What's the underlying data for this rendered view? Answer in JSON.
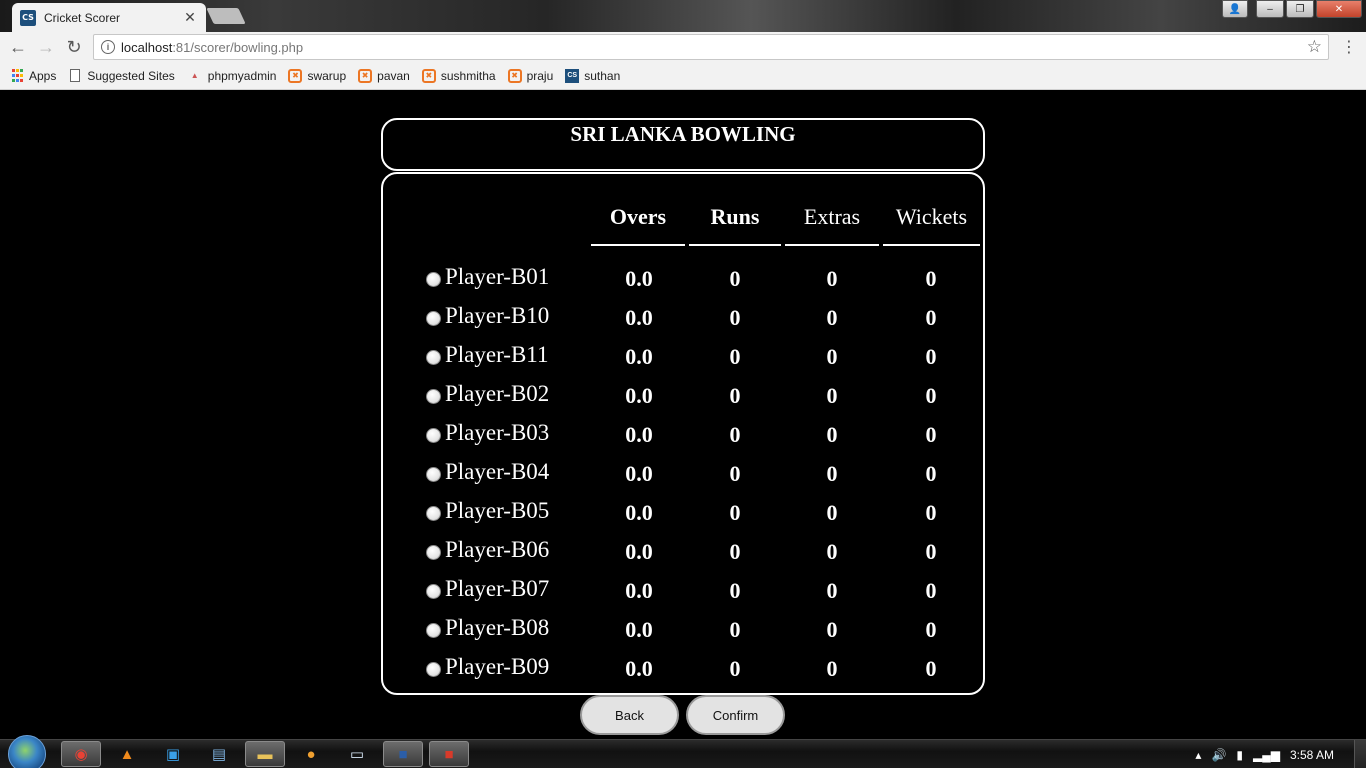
{
  "browser": {
    "tab_title": "Cricket Scorer",
    "tab_close": "✕",
    "favicon_text": "CS",
    "url_host": "localhost",
    "url_rest": ":81/scorer/bowling.php",
    "bookmarks": [
      {
        "label": "Apps",
        "icon": "apps-grid-icon"
      },
      {
        "label": "Suggested Sites",
        "icon": "page-icon"
      },
      {
        "label": "phpmyadmin",
        "icon": "phpmyadmin-icon"
      },
      {
        "label": "swarup",
        "icon": "xampp-icon"
      },
      {
        "label": "pavan",
        "icon": "xampp-icon"
      },
      {
        "label": "sushmitha",
        "icon": "xampp-icon"
      },
      {
        "label": "praju",
        "icon": "xampp-icon"
      },
      {
        "label": "suthan",
        "icon": "cs-icon"
      }
    ]
  },
  "page": {
    "title": "SRI LANKA BOWLING",
    "columns": [
      "Overs",
      "Runs",
      "Extras",
      "Wickets"
    ],
    "players": [
      {
        "name": "Player-B01",
        "overs": "0.0",
        "runs": "0",
        "extras": "0",
        "wickets": "0"
      },
      {
        "name": "Player-B10",
        "overs": "0.0",
        "runs": "0",
        "extras": "0",
        "wickets": "0"
      },
      {
        "name": "Player-B11",
        "overs": "0.0",
        "runs": "0",
        "extras": "0",
        "wickets": "0"
      },
      {
        "name": "Player-B02",
        "overs": "0.0",
        "runs": "0",
        "extras": "0",
        "wickets": "0"
      },
      {
        "name": "Player-B03",
        "overs": "0.0",
        "runs": "0",
        "extras": "0",
        "wickets": "0"
      },
      {
        "name": "Player-B04",
        "overs": "0.0",
        "runs": "0",
        "extras": "0",
        "wickets": "0"
      },
      {
        "name": "Player-B05",
        "overs": "0.0",
        "runs": "0",
        "extras": "0",
        "wickets": "0"
      },
      {
        "name": "Player-B06",
        "overs": "0.0",
        "runs": "0",
        "extras": "0",
        "wickets": "0"
      },
      {
        "name": "Player-B07",
        "overs": "0.0",
        "runs": "0",
        "extras": "0",
        "wickets": "0"
      },
      {
        "name": "Player-B08",
        "overs": "0.0",
        "runs": "0",
        "extras": "0",
        "wickets": "0"
      },
      {
        "name": "Player-B09",
        "overs": "0.0",
        "runs": "0",
        "extras": "0",
        "wickets": "0"
      }
    ],
    "back_label": "Back",
    "confirm_label": "Confirm"
  },
  "taskbar": {
    "clock": "3:58 AM",
    "apps": [
      "chrome-icon",
      "vlc-icon",
      "app-icon",
      "paint-icon",
      "explorer-icon",
      "media-icon",
      "notepad-icon",
      "word-icon",
      "pdf-icon"
    ]
  },
  "colors": {
    "page_background": "#000000",
    "text": "#ffffff",
    "button_background": "#e3e3e3",
    "favicon": "#1d4f7c",
    "xampp": "#ec7624"
  }
}
